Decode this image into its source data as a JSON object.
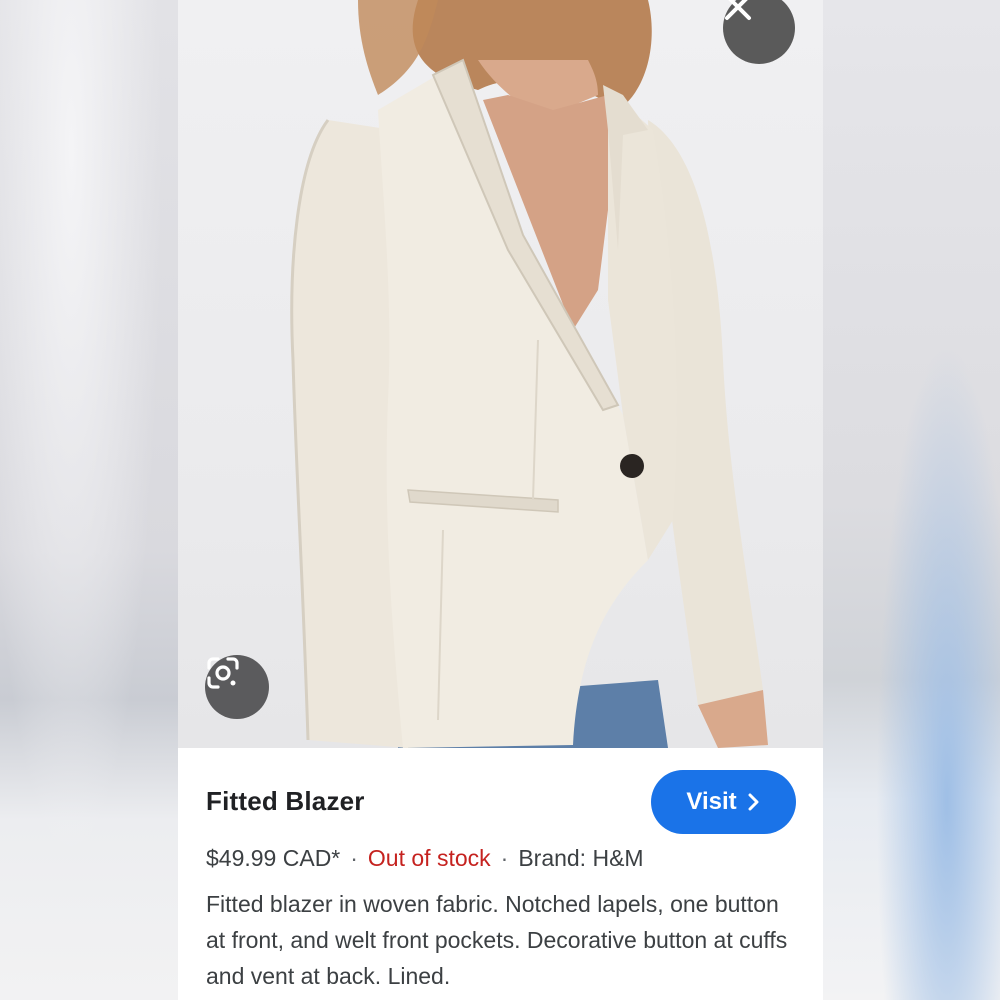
{
  "product": {
    "title": "Fitted Blazer",
    "price": "$49.99 CAD*",
    "stock_status": "Out of stock",
    "brand": "Brand: H&M",
    "separator": "·",
    "description": "Fitted blazer in woven fabric. Notched lapels, one button at front, and welt front pockets. Decorative button at cuffs and vent at back. Lined."
  },
  "actions": {
    "visit_label": "Visit",
    "close_icon": "close-icon",
    "lens_icon": "google-lens-icon",
    "visit_icon": "chevron-right-icon"
  },
  "colors": {
    "accent": "#1a73e8",
    "out_of_stock": "#c5221f",
    "title": "#202124"
  }
}
